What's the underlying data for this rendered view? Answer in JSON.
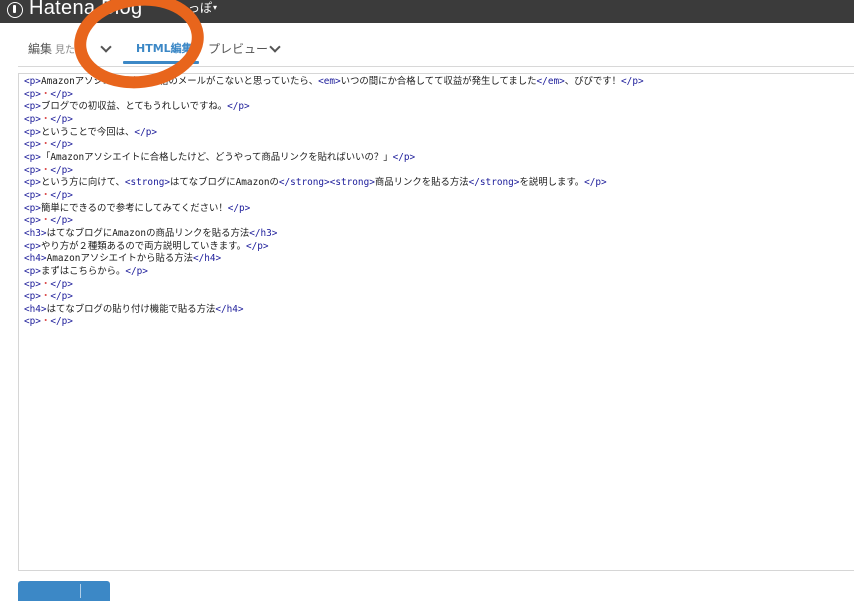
{
  "topbar": {
    "brand": "Hatena Blog",
    "blog_name": "しっぽ",
    "blog_caret": "▾"
  },
  "tabs": {
    "edit": {
      "label": "編集",
      "sub": "見たま"
    },
    "html": {
      "label": "HTML編集"
    },
    "preview": {
      "label": "プレビュー"
    }
  },
  "editor": {
    "lines": [
      "<p>Amazonアソシエイトから合格のメールがこないと思っていたら、<em>いつの間にか合格してて収益が発生してました</em>、びびです！</p>",
      "<p>・</p>",
      "<p>ブログでの初収益、とてもうれしいですね。</p>",
      "<p>・</p>",
      "<p>ということで今回は、</p>",
      "<p>・</p>",
      "<p>「Amazonアソシエイトに合格したけど、どうやって商品リンクを貼ればいいの？」</p>",
      "<p>・</p>",
      "<p>という方に向けて、<strong>はてなブログにAmazonの</strong><strong>商品リンクを貼る方法</strong>を説明します。</p>",
      "<p>・</p>",
      "<p>簡単にできるので参考にしてみてください！</p>",
      "<p>・</p>",
      "<h3>はてなブログにAmazonの商品リンクを貼る方法</h3>",
      "<p>やり方が２種類あるので両方説明していきます。</p>",
      "<h4>Amazonアソシエイトから貼る方法</h4>",
      "<p>まずはこちらから。</p>",
      "<p>・</p>",
      "<p>・</p>",
      "<h4>はてなブログの貼り付け機能で貼る方法</h4>",
      "<p>・</p>"
    ]
  },
  "colors": {
    "topbar": "#3b3b3b",
    "accent": "#3c88c6",
    "annotation": "#e8651c"
  }
}
